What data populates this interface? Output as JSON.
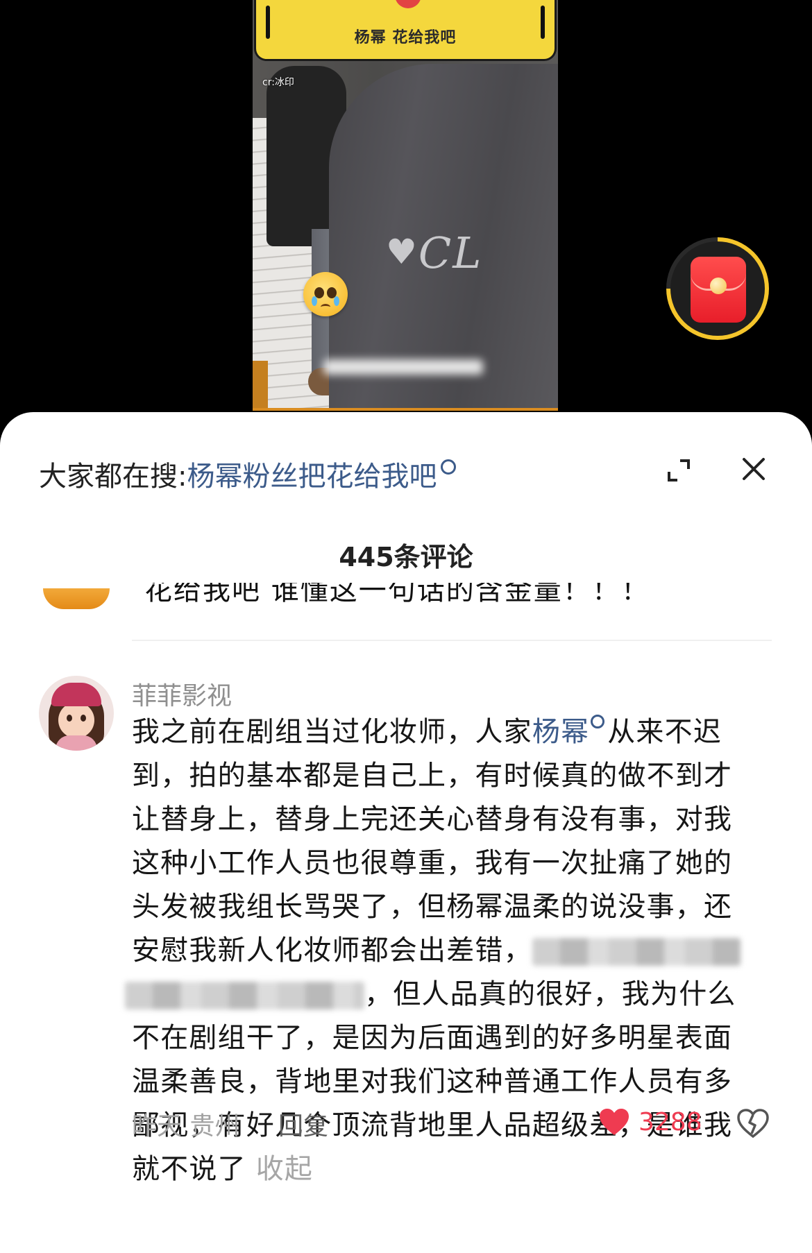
{
  "video": {
    "banner_text": "杨幂 花给我吧",
    "credit": "cr:冰印",
    "watermark": "CL"
  },
  "sheet": {
    "search_prefix": "大家都在搜:",
    "search_keyword": "杨幂粉丝把花给我吧",
    "comment_count": "445条评论",
    "partial_comment_text": "花给我吧 谁懂这一句话的含金量！！！"
  },
  "comment": {
    "username": "菲菲影视",
    "lines": {
      "l1_a": "我之前在剧组当过化妆师，人家",
      "l1_kw": "杨幂",
      "l1_b": "从来不迟",
      "l2": "到，拍的基本都是自己上，有时候真的做不到才",
      "l3": "让替身上，替身上完还关心替身有没有事，对我",
      "l4": "这种小工作人员也很尊重，我有一次扯痛了她的",
      "l5": "头发被我组长骂哭了，但杨幂温柔的说没事，还",
      "l6": "安慰我新人化妆师都会出差错，",
      "l7": "，但人品真的很好，我为什么",
      "l8": "不在剧组干了，是因为后面遇到的好多明星表面",
      "l9": "温柔善良，背地里对我们这种普通工作人员有多",
      "l10": "鄙视，有好几个顶流背地里人品超级差，是谁我",
      "l11": "就不说了"
    },
    "collapse_label": "收起",
    "time": "昨天",
    "location": "贵州",
    "reply_label": "回复",
    "like_count": "3288"
  },
  "colors": {
    "link": "#3c5b8a",
    "like": "#ef3b51",
    "banner": "#f4d73d"
  },
  "icons": [
    "search-icon",
    "expand-icon",
    "close-icon",
    "heart-icon",
    "dislike-icon",
    "red-packet-icon"
  ]
}
